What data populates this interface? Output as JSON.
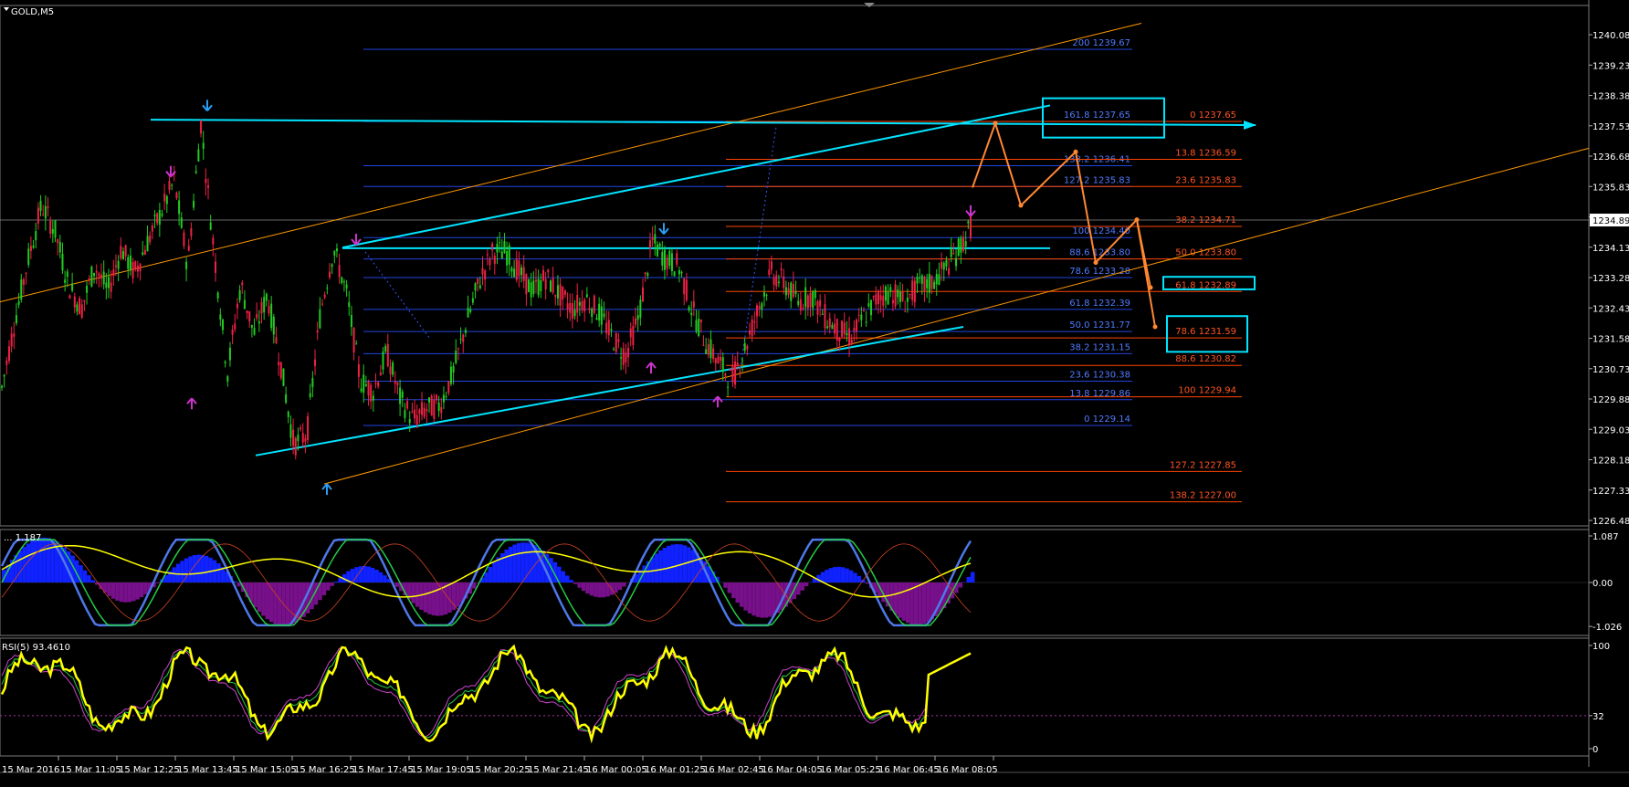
{
  "window": {
    "symbol_label": "GOLD,M5"
  },
  "chart_data": [
    {
      "type": "line",
      "title": "GOLD,M5",
      "subtype": "candlestick",
      "ylim": [
        1226.48,
        1240.08
      ],
      "price_ticks": [
        "1240.08",
        "1239.23",
        "1238.38",
        "1237.53",
        "1236.68",
        "1235.83",
        "1234.98",
        "1234.13",
        "1233.28",
        "1232.43",
        "1231.58",
        "1230.73",
        "1229.88",
        "1229.03",
        "1228.18",
        "1227.33",
        "1226.48"
      ],
      "current_price": "1234.89",
      "x_ticks": [
        "15 Mar 2016",
        "15 Mar 11:05",
        "15 Mar 12:25",
        "15 Mar 13:45",
        "15 Mar 15:05",
        "15 Mar 16:25",
        "15 Mar 17:45",
        "15 Mar 19:05",
        "15 Mar 20:25",
        "15 Mar 21:45",
        "16 Mar 00:05",
        "16 Mar 01:25",
        "16 Mar 02:45",
        "16 Mar 04:05",
        "16 Mar 05:25",
        "16 Mar 06:45",
        "16 Mar 08:05"
      ],
      "close_path": [
        1230.2,
        1232.1,
        1233.8,
        1235.3,
        1234.6,
        1233.1,
        1232.4,
        1233.6,
        1232.9,
        1234.1,
        1233.4,
        1234.3,
        1235.1,
        1236.0,
        1233.6,
        1237.6,
        1234.0,
        1230.6,
        1233.1,
        1231.7,
        1232.8,
        1230.9,
        1228.6,
        1228.9,
        1232.3,
        1234.1,
        1232.8,
        1230.4,
        1230.1,
        1231.2,
        1229.9,
        1229.3,
        1229.6,
        1229.7,
        1230.6,
        1232.0,
        1233.2,
        1234.0,
        1234.0,
        1233.4,
        1232.9,
        1233.3,
        1232.8,
        1232.4,
        1232.7,
        1232.3,
        1231.6,
        1231.1,
        1232.2,
        1234.3,
        1233.8,
        1233.6,
        1232.4,
        1231.5,
        1230.9,
        1230.4,
        1231.3,
        1232.4,
        1233.4,
        1233.1,
        1232.6,
        1232.8,
        1232.2,
        1231.8,
        1231.6,
        1232.2,
        1232.7,
        1232.9,
        1232.6,
        1233.0,
        1233.1,
        1233.5,
        1234.0,
        1234.7
      ],
      "fib_blue": [
        {
          "level": "200",
          "price": "1239.67"
        },
        {
          "level": "161.8",
          "price": "1237.65"
        },
        {
          "level": "138.2",
          "price": "1236.41"
        },
        {
          "level": "127.2",
          "price": "1235.83"
        },
        {
          "level": "100",
          "price": "1234.40"
        },
        {
          "level": "88.6",
          "price": "1233.80"
        },
        {
          "level": "78.6",
          "price": "1233.28"
        },
        {
          "level": "61.8",
          "price": "1232.39"
        },
        {
          "level": "50.0",
          "price": "1231.77"
        },
        {
          "level": "38.2",
          "price": "1231.15"
        },
        {
          "level": "23.6",
          "price": "1230.38"
        },
        {
          "level": "13.8",
          "price": "1229.86"
        },
        {
          "level": "0",
          "price": "1229.14"
        }
      ],
      "fib_red": [
        {
          "level": "0",
          "price": "1237.65"
        },
        {
          "level": "13.8",
          "price": "1236.59"
        },
        {
          "level": "23.6",
          "price": "1235.83"
        },
        {
          "level": "38.2",
          "price": "1234.71"
        },
        {
          "level": "50.0",
          "price": "1233.80"
        },
        {
          "level": "61.8",
          "price": "1232.89"
        },
        {
          "level": "78.6",
          "price": "1231.59"
        },
        {
          "level": "88.6",
          "price": "1230.82"
        },
        {
          "level": "100",
          "price": "1229.94"
        },
        {
          "level": "127.2",
          "price": "1227.85"
        },
        {
          "level": "138.2",
          "price": "1227.00"
        }
      ],
      "colors": {
        "blue_fib": "#2244dd",
        "red_fib": "#ff4400",
        "trend": "#00e5ff",
        "channel": "#ff9900",
        "projection": "#ff8833",
        "bull": "#22cc22",
        "bear": "#ee2244"
      }
    },
    {
      "type": "line",
      "title_label": "... 1.187",
      "ylim": [
        -1.026,
        1.087
      ],
      "ticks": [
        "1.087",
        "0.00",
        "-1.026"
      ]
    },
    {
      "type": "line",
      "title_label": "RSI(5) 93.4610",
      "ylim": [
        0,
        100
      ],
      "ticks": [
        "100",
        "32",
        "0"
      ]
    }
  ]
}
